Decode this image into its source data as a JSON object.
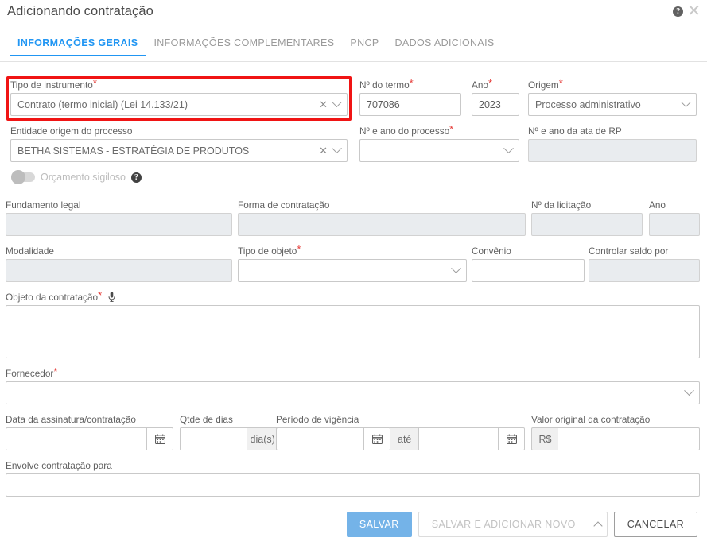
{
  "header": {
    "title": "Adicionando contratação",
    "help_icon": "help-circle-icon",
    "close_icon": "close-icon"
  },
  "tabs": [
    {
      "label": "INFORMAÇÕES GERAIS",
      "active": true
    },
    {
      "label": "INFORMAÇÕES COMPLEMENTARES",
      "active": false
    },
    {
      "label": "PNCP",
      "active": false
    },
    {
      "label": "DADOS ADICIONAIS",
      "active": false
    }
  ],
  "fields": {
    "tipo_instrumento": {
      "label": "Tipo de instrumento",
      "required": true,
      "value": "Contrato (termo inicial) (Lei 14.133/21)",
      "highlighted": true
    },
    "numero_termo": {
      "label": "Nº do termo",
      "required": true,
      "value": "707086"
    },
    "ano": {
      "label": "Ano",
      "required": true,
      "value": "2023"
    },
    "origem": {
      "label": "Origem",
      "required": true,
      "value": "Processo administrativo"
    },
    "entidade_origem": {
      "label": "Entidade origem do processo",
      "required": false,
      "value": "BETHA SISTEMAS - ESTRATÉGIA DE PRODUTOS"
    },
    "numero_ano_processo": {
      "label": "Nº e ano do processo",
      "required": true,
      "value": ""
    },
    "numero_ano_ata_rp": {
      "label": "Nº e ano da ata de RP",
      "required": false,
      "value": "",
      "disabled": true
    },
    "orcamento_sigiloso": {
      "label": "Orçamento sigiloso",
      "enabled": false,
      "help_icon": "help-circle-icon"
    },
    "fundamento_legal": {
      "label": "Fundamento legal",
      "required": false,
      "value": "",
      "disabled": true
    },
    "forma_contratacao": {
      "label": "Forma de contratação",
      "required": false,
      "value": "",
      "disabled": true
    },
    "numero_licitacao": {
      "label": "Nº da licitação",
      "required": false,
      "value": "",
      "disabled": true
    },
    "ano_licitacao": {
      "label": "Ano",
      "required": false,
      "value": "",
      "disabled": true
    },
    "modalidade": {
      "label": "Modalidade",
      "required": false,
      "value": "",
      "disabled": true
    },
    "tipo_objeto": {
      "label": "Tipo de objeto",
      "required": true,
      "value": ""
    },
    "convenio": {
      "label": "Convênio",
      "required": false,
      "value": ""
    },
    "controlar_saldo_por": {
      "label": "Controlar saldo por",
      "required": false,
      "value": "",
      "disabled": true
    },
    "objeto_contratacao": {
      "label": "Objeto da contratação",
      "required": true,
      "value": "",
      "mic_icon": "microphone-icon"
    },
    "fornecedor": {
      "label": "Fornecedor",
      "required": true,
      "value": ""
    },
    "data_assinatura": {
      "label": "Data da assinatura/contratação",
      "required": false,
      "value": "",
      "calendar_icon": "calendar-icon"
    },
    "qtde_dias": {
      "label": "Qtde de dias",
      "required": false,
      "value": "",
      "addon": "dia(s)"
    },
    "periodo_vigencia": {
      "label": "Período de vigência",
      "required": false,
      "start_value": "",
      "separator": "até",
      "end_value": "",
      "calendar_icon": "calendar-icon"
    },
    "valor_original": {
      "label": "Valor original da contratação",
      "required": false,
      "prefix": "R$",
      "value": ""
    },
    "envolve_contratacao_para": {
      "label": "Envolve contratação para",
      "required": false,
      "value": ""
    }
  },
  "footer": {
    "salvar": "SALVAR",
    "salvar_adicionar_novo": "SALVAR E ADICIONAR NOVO",
    "caret_icon": "chevron-up-icon",
    "cancelar": "CANCELAR"
  },
  "colors": {
    "accent": "#2196f3",
    "primary_button": "#74b3e8",
    "required_marker": "#e53935",
    "highlight_border": "#f01414",
    "label_text": "#616161",
    "disabled_field": "#e9ecef"
  }
}
